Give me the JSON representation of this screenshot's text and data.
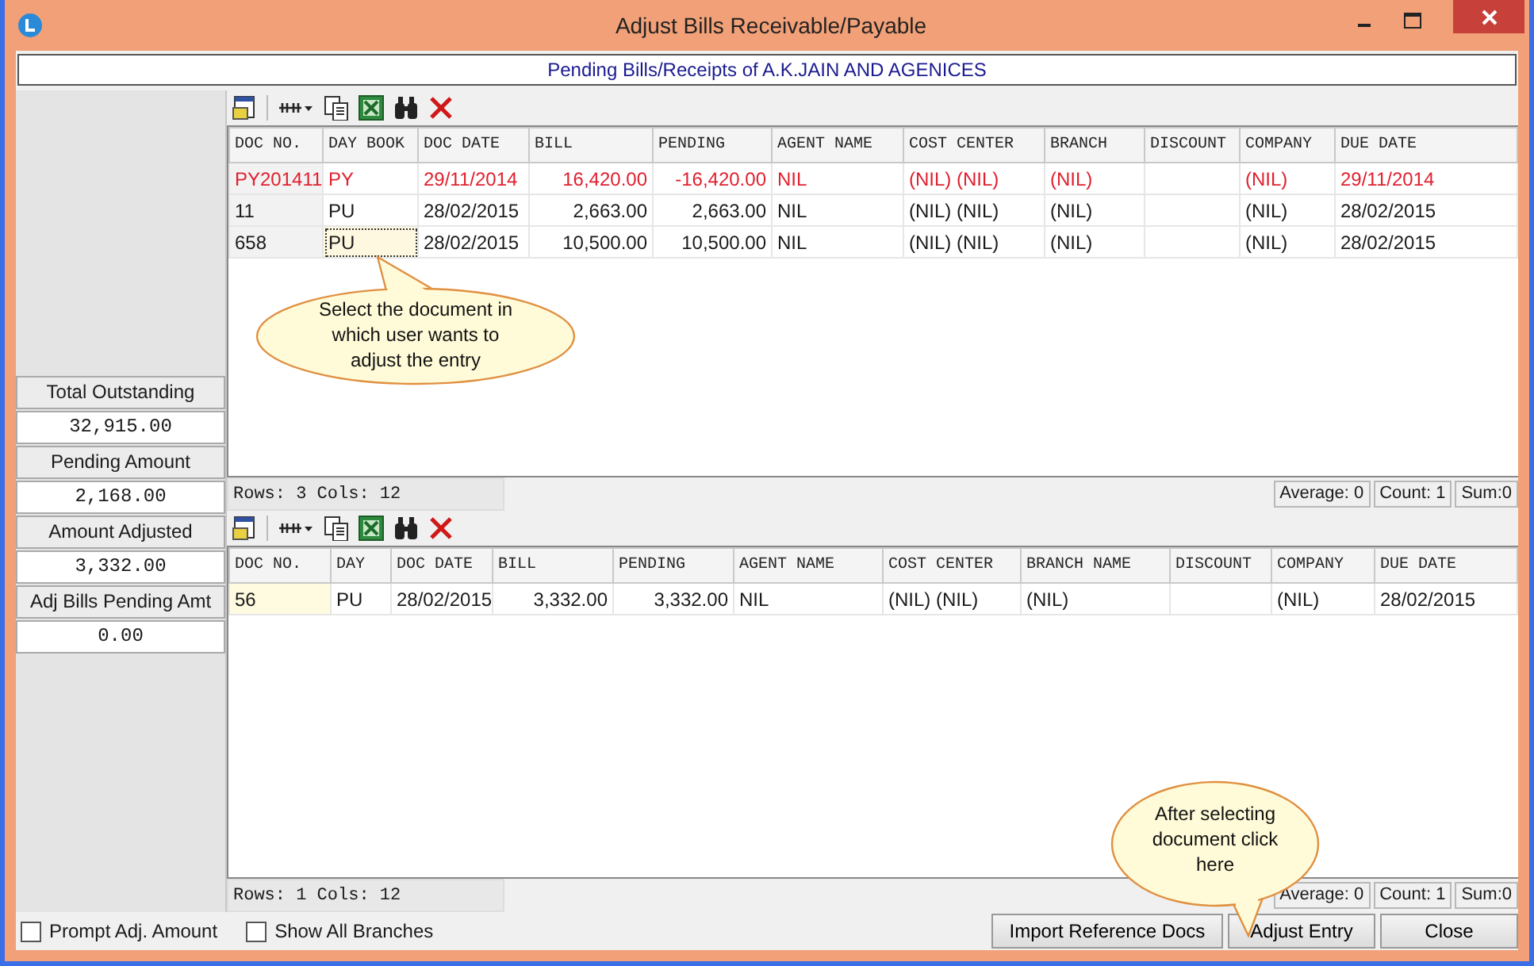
{
  "window": {
    "title": "Adjust Bills Receivable/Payable"
  },
  "header": "Pending Bills/Receipts of A.K.JAIN AND AGENICES",
  "summary": [
    {
      "label": "Total Outstanding",
      "value": "32,915.00"
    },
    {
      "label": "Pending Amount",
      "value": "2,168.00"
    },
    {
      "label": "Amount Adjusted",
      "value": "3,332.00"
    },
    {
      "label": "Adj Bills Pending Amt",
      "value": "0.00"
    }
  ],
  "grids": [
    {
      "columns": [
        "DOC NO.",
        "DAY BOOK",
        "DOC DATE",
        "BILL",
        "PENDING",
        "AGENT NAME",
        "COST CENTER",
        "BRANCH",
        "DISCOUNT",
        "COMPANY",
        "DUE DATE"
      ],
      "rows": [
        {
          "color": "#e0202e",
          "selected": false,
          "cells": [
            "PY201411",
            "PY",
            "29/11/2014",
            "16,420.00",
            "-16,420.00",
            "NIL",
            "(NIL) (NIL)",
            "(NIL)",
            "",
            "(NIL)",
            "29/11/2014"
          ]
        },
        {
          "color": "#1a1a1a",
          "selected": false,
          "cells": [
            "11",
            "PU",
            "28/02/2015",
            "2,663.00",
            "2,663.00",
            "NIL",
            "(NIL) (NIL)",
            "(NIL)",
            "",
            "(NIL)",
            "28/02/2015"
          ]
        },
        {
          "color": "#1a1a1a",
          "selected": true,
          "cells": [
            "658",
            "PU",
            "28/02/2015",
            "10,500.00",
            "10,500.00",
            "NIL",
            "(NIL) (NIL)",
            "(NIL)",
            "",
            "(NIL)",
            "28/02/2015"
          ]
        }
      ],
      "footer": {
        "counts": "Rows: 3  Cols: 12",
        "average": "Average: 0",
        "count": "Count: 1",
        "sum": "Sum:0"
      }
    },
    {
      "columns": [
        "DOC NO.",
        "DAY",
        "DOC DATE",
        "BILL",
        "PENDING",
        "AGENT NAME",
        "COST CENTER",
        "BRANCH NAME",
        "DISCOUNT",
        "COMPANY",
        "DUE DATE"
      ],
      "rows": [
        {
          "color": "#1a1a1a",
          "selected": true,
          "cells": [
            "56",
            "PU",
            "28/02/2015",
            "3,332.00",
            "3,332.00",
            "NIL",
            "(NIL) (NIL)",
            "(NIL)",
            "",
            "(NIL)",
            "28/02/2015"
          ]
        }
      ],
      "footer": {
        "counts": "Rows: 1  Cols: 12",
        "average": "Average: 0",
        "count": "Count: 1",
        "sum": "Sum:0"
      }
    }
  ],
  "checkboxes": [
    {
      "label": "Prompt Adj. Amount",
      "checked": false
    },
    {
      "label": "Show All Branches",
      "checked": false
    }
  ],
  "buttons": [
    "Import Reference Docs",
    "Adjust Entry",
    "Close"
  ],
  "callouts": [
    "Select the document in which user wants to adjust the entry",
    "After selecting document click here"
  ]
}
